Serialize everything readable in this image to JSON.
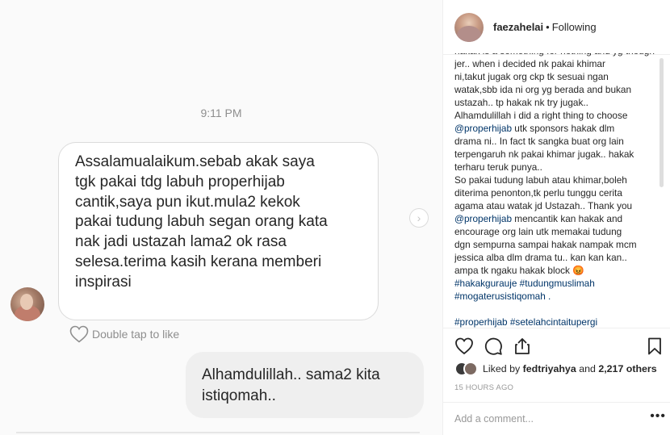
{
  "dm": {
    "time": "9:11 PM",
    "incoming_lines": [
      "Assalamualaikum.sebab akak saya",
      "tgk pakai tdg labuh properhijab",
      "cantik,saya pun ikut.mula2 kekok",
      "pakai tudung labuh segan orang kata",
      "nak jadi ustazah lama2 ok rasa",
      "selesa.terima kasih kerana memberi",
      "inspirasi"
    ],
    "like_hint": "Double tap to like",
    "outgoing_lines": [
      "Alhamdulillah.. sama2 kita",
      "istiqomah.."
    ],
    "next_icon": "chevron-right-icon"
  },
  "post": {
    "username": "faezahelai",
    "separator": "•",
    "follow_status": "Following",
    "caption_lines": [
      "jer.. when i decided nk pakai khimar",
      "ni,takut jugak org ckp tk sesuai ngan",
      "watak,sbb ida ni org yg berada and bukan",
      "ustazah.. tp hakak nk try jugak..",
      "Alhamdulillah i did a right thing to choose",
      "@properhijab utk sponsors hakak dlm",
      "drama ni.. In fact tk sangka buat org lain",
      "terpengaruh nk pakai khimar jugak.. hakak",
      "terharu teruk punya..",
      "So pakai tudung labuh atau khimar,boleh",
      "diterima penonton,tk perlu tunggu cerita",
      "agama atau watak jd Ustazah.. Thank you",
      "@properhijab mencantik kan hakak and",
      "encourage org lain utk memakai tudung",
      "dgn sempurna sampai hakak nampak mcm",
      "jessica alba dlm drama tu.. kan kan kan..",
      "ampa tk ngaku hakak block 😡",
      "#hakakgurauje #tudungmuslimah",
      "#mogaterusistiqomah .",
      "",
      "#properhijab #setelahcintaitupergi"
    ],
    "mention": "@properhijab",
    "likes": {
      "prefix": "Liked by",
      "user": "fedtriyahya",
      "conjunction": "and",
      "count_text": "2,217 others"
    },
    "timestamp": "15 HOURS AGO",
    "comment_placeholder": "Add a comment...",
    "more_label": "•••",
    "icons": [
      "heart-icon",
      "comment-icon",
      "share-icon",
      "bookmark-icon"
    ],
    "colors": {
      "hashtag": "#003569",
      "muted": "#999999",
      "border": "#efefef"
    }
  }
}
